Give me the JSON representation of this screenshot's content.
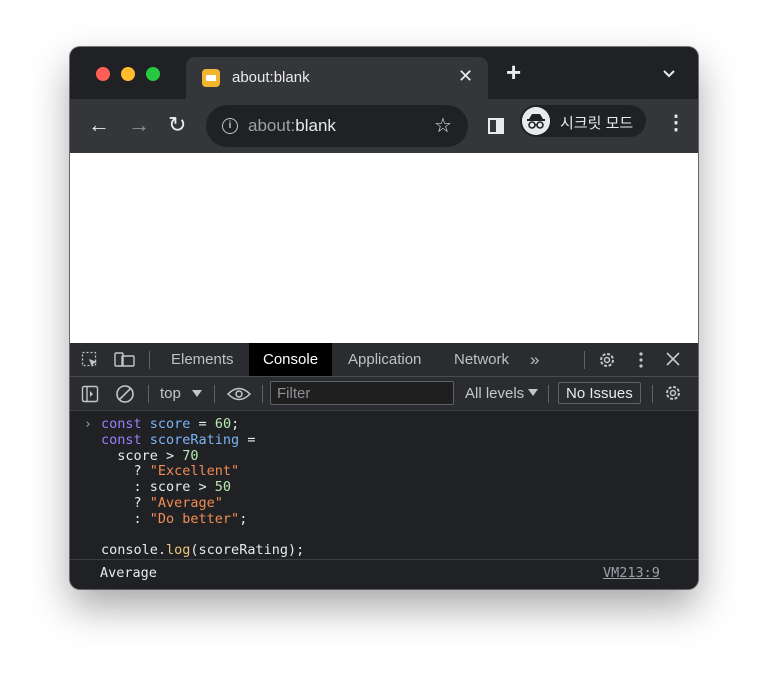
{
  "tab": {
    "title": "about:blank",
    "close_glyph": "✕",
    "new_tab_glyph": "+",
    "tab_list_glyph": "⌄"
  },
  "toolbar": {
    "back_glyph": "←",
    "forward_glyph": "→",
    "reload_glyph": "↻",
    "url_prefix": "about:",
    "url_host": "blank",
    "star_glyph": "☆",
    "incognito_label": "시크릿 모드",
    "menu_glyph": "⋮"
  },
  "devtools": {
    "tabs": [
      "Elements",
      "Console",
      "Application",
      "Network"
    ],
    "active_tab": "Console",
    "more_tabs_glyph": "»",
    "context": "top",
    "filter_placeholder": "Filter",
    "levels": "All levels",
    "issues": "No Issues"
  },
  "console": {
    "code_lines": [
      "const score = 60;",
      "const scoreRating =",
      "  score > 70",
      "    ? \"Excellent\"",
      "    : score > 50",
      "    ? \"Average\"",
      "    : \"Do better\";",
      "",
      "console.log(scoreRating);"
    ],
    "output": "Average",
    "source_link": "VM213:9"
  },
  "colors": {
    "window_bg": "#202124",
    "toolbar_bg": "#35363a",
    "active_tab_bg": "#000000",
    "keyword": "#9980ff",
    "variable": "#7ab4f5",
    "string": "#f28b54"
  }
}
